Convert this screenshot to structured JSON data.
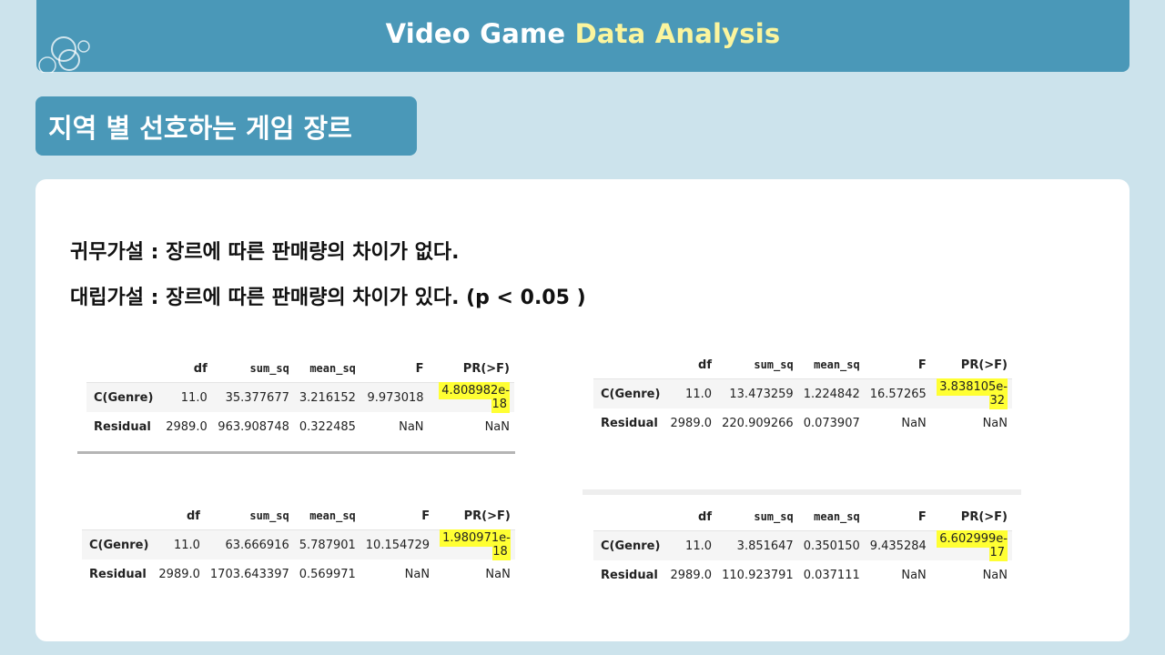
{
  "header": {
    "title_part1": "Video Game ",
    "title_part2": "Data Analysis"
  },
  "section": {
    "title": "지역 별 선호하는 게임 장르"
  },
  "hypotheses": {
    "null": "귀무가설 : 장르에 따른 판매량의 차이가 없다.",
    "alternative": "대립가설 : 장르에 따른 판매량의 차이가 있다. (p < 0.05 )"
  },
  "anova_tables": [
    {
      "columns": [
        "",
        "df",
        "sum_sq",
        "mean_sq",
        "F",
        "PR(>F)"
      ],
      "rows": [
        {
          "index": "C(Genre)",
          "df": "11.0",
          "sum_sq": "35.377677",
          "mean_sq": "3.216152",
          "F": "9.973018",
          "pr": "4.808982e-18"
        },
        {
          "index": "Residual",
          "df": "2989.0",
          "sum_sq": "963.908748",
          "mean_sq": "0.322485",
          "F": "NaN",
          "pr": "NaN"
        }
      ]
    },
    {
      "columns": [
        "",
        "df",
        "sum_sq",
        "mean_sq",
        "F",
        "PR(>F)"
      ],
      "rows": [
        {
          "index": "C(Genre)",
          "df": "11.0",
          "sum_sq": "13.473259",
          "mean_sq": "1.224842",
          "F": "16.57265",
          "pr": "3.838105e-32"
        },
        {
          "index": "Residual",
          "df": "2989.0",
          "sum_sq": "220.909266",
          "mean_sq": "0.073907",
          "F": "NaN",
          "pr": "NaN"
        }
      ]
    },
    {
      "columns": [
        "",
        "df",
        "sum_sq",
        "mean_sq",
        "F",
        "PR(>F)"
      ],
      "rows": [
        {
          "index": "C(Genre)",
          "df": "11.0",
          "sum_sq": "63.666916",
          "mean_sq": "5.787901",
          "F": "10.154729",
          "pr": "1.980971e-18"
        },
        {
          "index": "Residual",
          "df": "2989.0",
          "sum_sq": "1703.643397",
          "mean_sq": "0.569971",
          "F": "NaN",
          "pr": "NaN"
        }
      ]
    },
    {
      "columns": [
        "",
        "df",
        "sum_sq",
        "mean_sq",
        "F",
        "PR(>F)"
      ],
      "rows": [
        {
          "index": "C(Genre)",
          "df": "11.0",
          "sum_sq": "3.851647",
          "mean_sq": "0.350150",
          "F": "9.435284",
          "pr": "6.602999e-17"
        },
        {
          "index": "Residual",
          "df": "2989.0",
          "sum_sq": "110.923791",
          "mean_sq": "0.037111",
          "F": "NaN",
          "pr": "NaN"
        }
      ]
    }
  ],
  "colors": {
    "header_bg": "#4a98b8",
    "page_bg": "#cce3ec",
    "accent_text": "#fbf59e",
    "highlight": "#ffff33"
  }
}
